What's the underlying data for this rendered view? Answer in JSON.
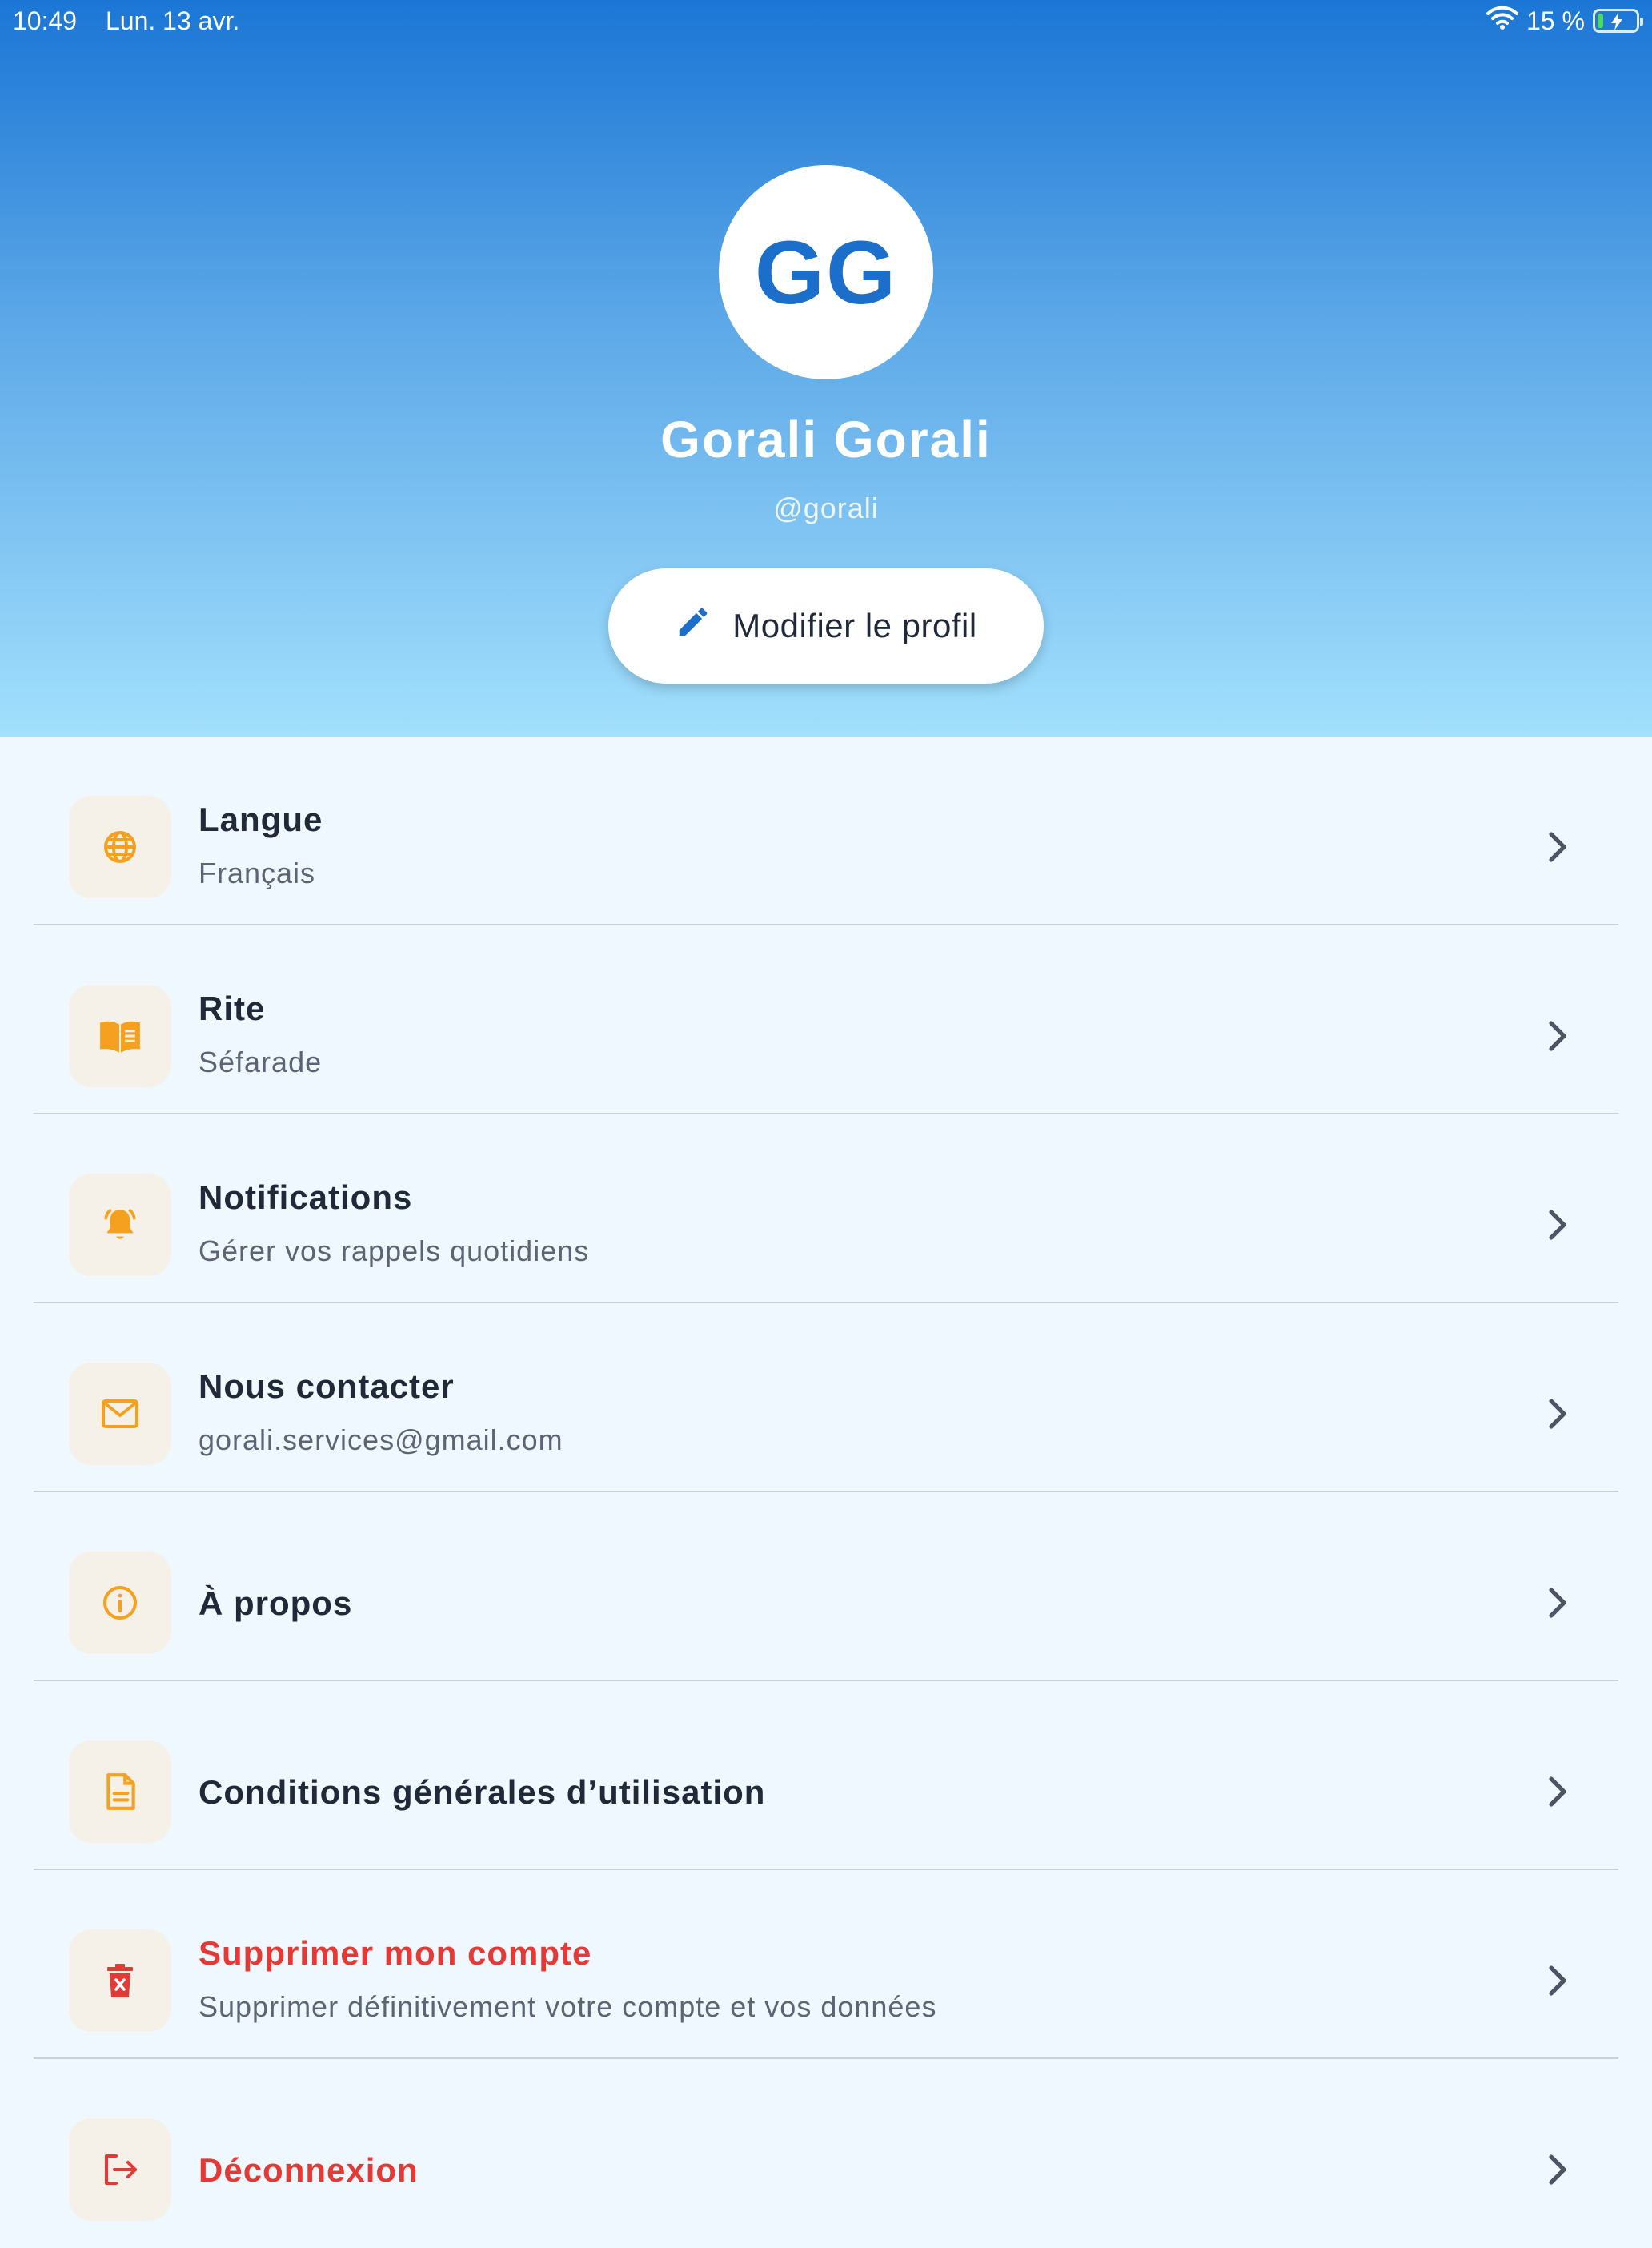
{
  "status_bar": {
    "time": "10:49",
    "date": "Lun. 13 avr.",
    "battery": "15 %"
  },
  "profile": {
    "initials": "GG",
    "name": "Gorali Gorali",
    "handle": "@gorali",
    "edit_label": "Modifier le profil"
  },
  "menu": {
    "items": [
      {
        "title": "Langue",
        "subtitle": "Français",
        "icon": "globe-icon"
      },
      {
        "title": "Rite",
        "subtitle": "Séfarade",
        "icon": "book-icon"
      },
      {
        "title": "Notifications",
        "subtitle": "Gérer vos rappels quotidiens",
        "icon": "bell-icon"
      },
      {
        "title": "Nous contacter",
        "subtitle": "gorali.services@gmail.com",
        "icon": "mail-icon"
      },
      {
        "title": "À propos",
        "icon": "info-icon"
      },
      {
        "title": "Conditions générales d’utilisation",
        "icon": "document-icon"
      },
      {
        "title": "Supprimer mon compte",
        "subtitle": "Supprimer définitivement votre compte et vos données",
        "icon": "trash-icon"
      },
      {
        "title": "Déconnexion",
        "icon": "logout-icon"
      }
    ]
  },
  "colors": {
    "accent_orange": "#f5a11f",
    "brand_blue": "#1b6fcb",
    "danger_red": "#e53935"
  }
}
